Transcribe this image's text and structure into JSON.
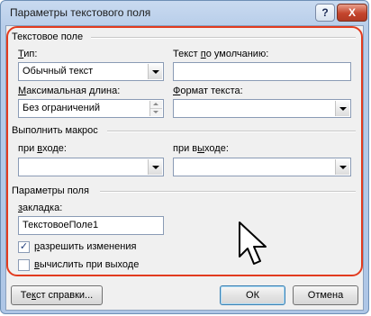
{
  "title": "Параметры текстового поля",
  "titlebar": {
    "help_label": "?",
    "close_label": "X"
  },
  "text_field_group": {
    "label": "Текстовое поле"
  },
  "type": {
    "label": "Тип:",
    "value": "Обычный текст"
  },
  "default_text": {
    "label": "Текст по умолчанию:",
    "value": ""
  },
  "max_length": {
    "label": "Максимальная длина:",
    "value": "Без ограничений"
  },
  "text_format": {
    "label": "Формат текста:",
    "value": ""
  },
  "run_macro_group": {
    "label": "Выполнить макрос"
  },
  "on_entry": {
    "label": "при входе:",
    "value": ""
  },
  "on_exit": {
    "label": "при выходе:",
    "value": ""
  },
  "field_settings_group": {
    "label": "Параметры поля"
  },
  "bookmark": {
    "label": "закладка:",
    "value": "ТекстовоеПоле1"
  },
  "fill_in_enabled": {
    "label": "разрешить изменения",
    "checked": true,
    "mark": "✓"
  },
  "calc_on_exit": {
    "label": "вычислить при выходе",
    "checked": false
  },
  "buttons": {
    "help_text": "Текст справки...",
    "ok": "ОК",
    "cancel": "Отмена"
  },
  "colors": {
    "highlight": "#e23b1f",
    "title_bar": "#b7cde9"
  },
  "icons": {
    "pointer": "mouse-pointer-icon"
  }
}
